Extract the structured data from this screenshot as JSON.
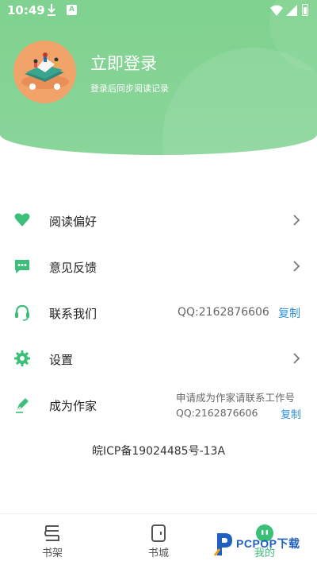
{
  "status_bar": {
    "time": "10:49",
    "app_badge": "A"
  },
  "profile": {
    "title": "立即登录",
    "subtitle": "登录后同步阅读记录"
  },
  "menu": {
    "reading_pref": {
      "label": "阅读偏好"
    },
    "feedback": {
      "label": "意见反馈"
    },
    "contact": {
      "label": "联系我们",
      "qq": "QQ:2162876606",
      "copy": "复制"
    },
    "settings": {
      "label": "设置"
    },
    "become_writer": {
      "label": "成为作家",
      "hint": "申请成为作家请联系工作号",
      "qq": "QQ:2162876606",
      "copy": "复制"
    }
  },
  "icp": "皖ICP备19024485号-13A",
  "bottom_nav": {
    "bookshelf": "书架",
    "bookstore": "书城",
    "mine": "我的"
  },
  "watermark": {
    "text": "PCPOP下载"
  },
  "colors": {
    "brand_green": "#7fd28f",
    "icon_green": "#3cbf78",
    "link_blue": "#2e8fd8"
  }
}
